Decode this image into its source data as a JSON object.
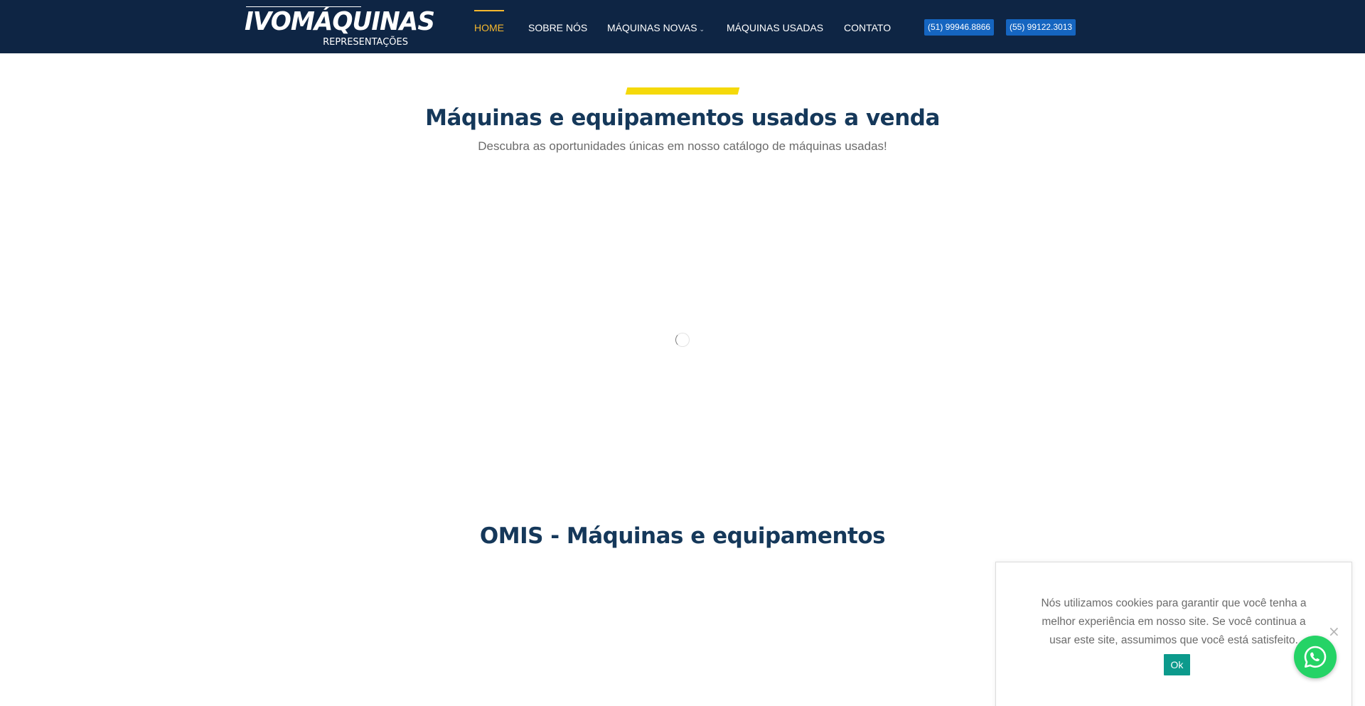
{
  "header": {
    "logo": {
      "main": "IVOMÁQUINAS",
      "sub": "REPRESENTAÇÕES"
    },
    "nav": [
      {
        "label": "HOME",
        "active": true
      },
      {
        "label": "SOBRE NÓS"
      },
      {
        "label": "MÁQUINAS NOVAS",
        "dropdown": true
      },
      {
        "label": "MÁQUINAS USADAS"
      },
      {
        "label": "CONTATO"
      }
    ],
    "phones": [
      "(51) 99946.8866",
      "(55) 99122.3013"
    ]
  },
  "used_section": {
    "title": "Máquinas e equipamentos usados a venda",
    "subtitle": "Descubra as oportunidades únicas em nosso catálogo de máquinas usadas!"
  },
  "omis_section": {
    "title": "OMIS - Máquinas e equipamentos"
  },
  "cookie_banner": {
    "text": "Nós utilizamos cookies para garantir que você tenha a melhor experiência em nosso site. Se você continua a usar este site, assumimos que você está satisfeito.",
    "ok_label": "Ok",
    "close_icon": "close-icon"
  },
  "whatsapp": {
    "icon": "whatsapp-icon"
  },
  "colors": {
    "header_bg": "#0e2544",
    "nav_active": "#f5b82e",
    "phone_bg": "#1565c0",
    "accent_bar": "#f5d90a",
    "heading": "#15385a",
    "cookie_button": "#0c9a8c",
    "whatsapp": "#25d366"
  }
}
